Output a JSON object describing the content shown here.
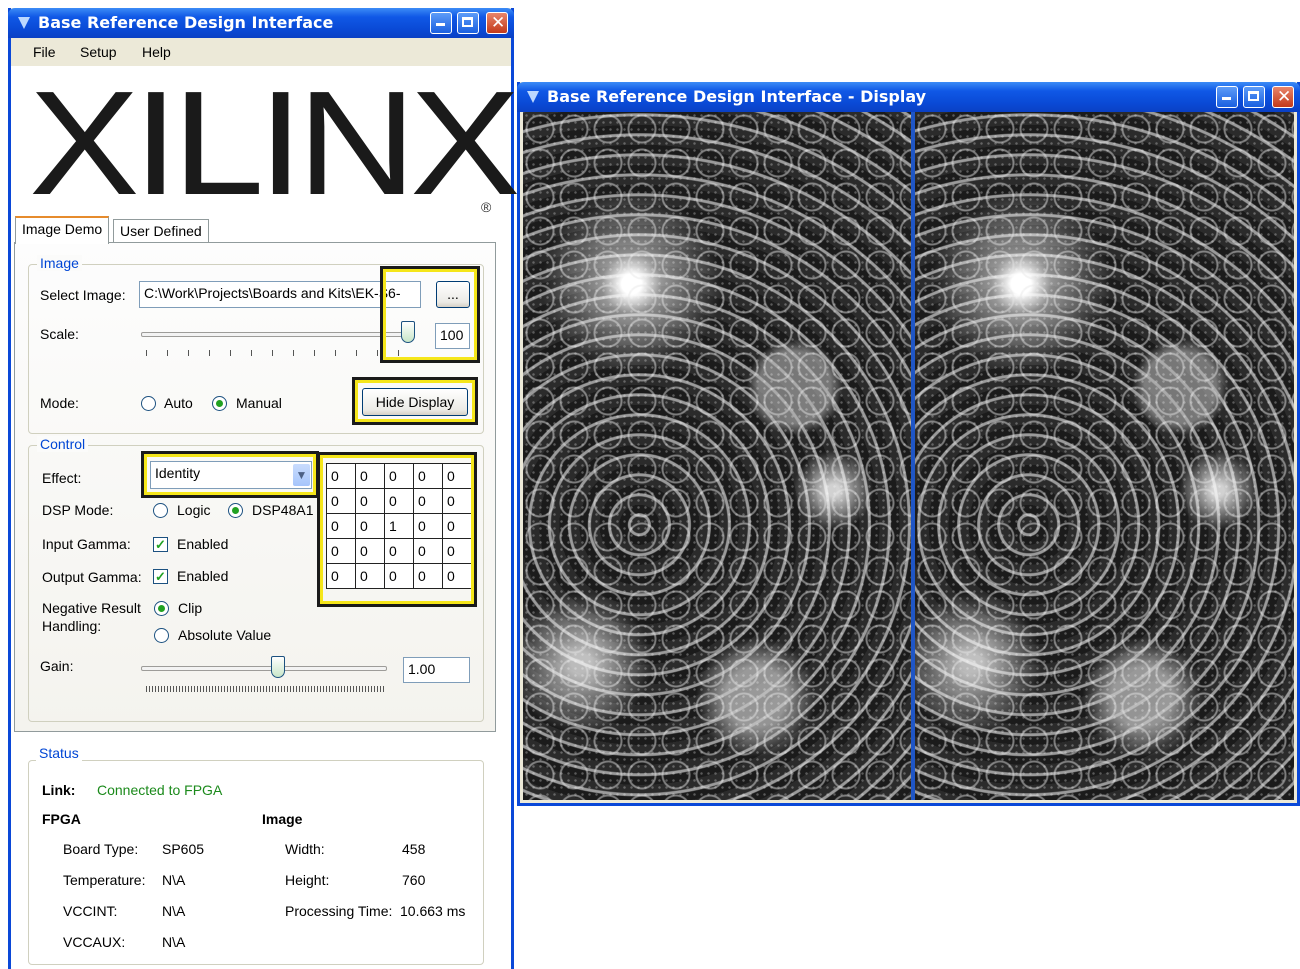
{
  "main_window": {
    "title": "Base Reference Design Interface",
    "menu": [
      "File",
      "Setup",
      "Help"
    ],
    "logo_text": "XILINX",
    "logo_mark": "®",
    "tabs": [
      "Image Demo",
      "User Defined"
    ],
    "image_group": {
      "label": "Image",
      "select_label": "Select Image:",
      "path_value": "C:\\Work\\Projects\\Boards and Kits\\EK-S6-",
      "browse_label": "...",
      "scale_label": "Scale:",
      "scale_value": "100",
      "scale_level_percent": 100,
      "mode_label": "Mode:",
      "mode_auto": "Auto",
      "mode_manual": "Manual",
      "mode_selected": "Manual",
      "hide_display_label": "Hide Display"
    },
    "control_group": {
      "label": "Control",
      "effect_label": "Effect:",
      "effect_value": "Identity",
      "dsp_mode_label": "DSP Mode:",
      "dsp_logic": "Logic",
      "dsp_48a1": "DSP48A1",
      "dsp_selected": "DSP48A1",
      "input_gamma_label": "Input Gamma:",
      "input_gamma_value": "Enabled",
      "output_gamma_label": "Output Gamma:",
      "output_gamma_value": "Enabled",
      "negative_label_1": "Negative Result",
      "negative_label_2": "Handling:",
      "neg_clip": "Clip",
      "neg_abs": "Absolute Value",
      "neg_selected": "Clip",
      "gain_label": "Gain:",
      "gain_value": "1.00",
      "gain_level_percent": 56,
      "kernel": [
        [
          "0",
          "0",
          "0",
          "0",
          "0"
        ],
        [
          "0",
          "0",
          "0",
          "0",
          "0"
        ],
        [
          "0",
          "0",
          "1",
          "0",
          "0"
        ],
        [
          "0",
          "0",
          "0",
          "0",
          "0"
        ],
        [
          "0",
          "0",
          "0",
          "0",
          "0"
        ]
      ]
    },
    "status_group": {
      "label": "Status",
      "link_label": "Link:",
      "link_value": "Connected to FPGA",
      "fpga_heading": "FPGA",
      "image_heading": "Image",
      "board_type_label": "Board Type:",
      "board_type_value": "SP605",
      "temperature_label": "Temperature:",
      "temperature_value": "N\\A",
      "vccint_label": "VCCINT:",
      "vccint_value": "N\\A",
      "vccaux_label": "VCCAUX:",
      "vccaux_value": "N\\A",
      "width_label": "Width:",
      "width_value": "458",
      "height_label": "Height:",
      "height_value": "760",
      "processing_time_label": "Processing Time:",
      "processing_time_value": "10.663 ms"
    }
  },
  "display_window": {
    "title": "Base Reference Design Interface - Display"
  },
  "colors": {
    "titlebar": "#0a4ad6",
    "highlight": "#f5e61a",
    "connected": "#1b8a1b",
    "group_label": "#0046d5"
  }
}
